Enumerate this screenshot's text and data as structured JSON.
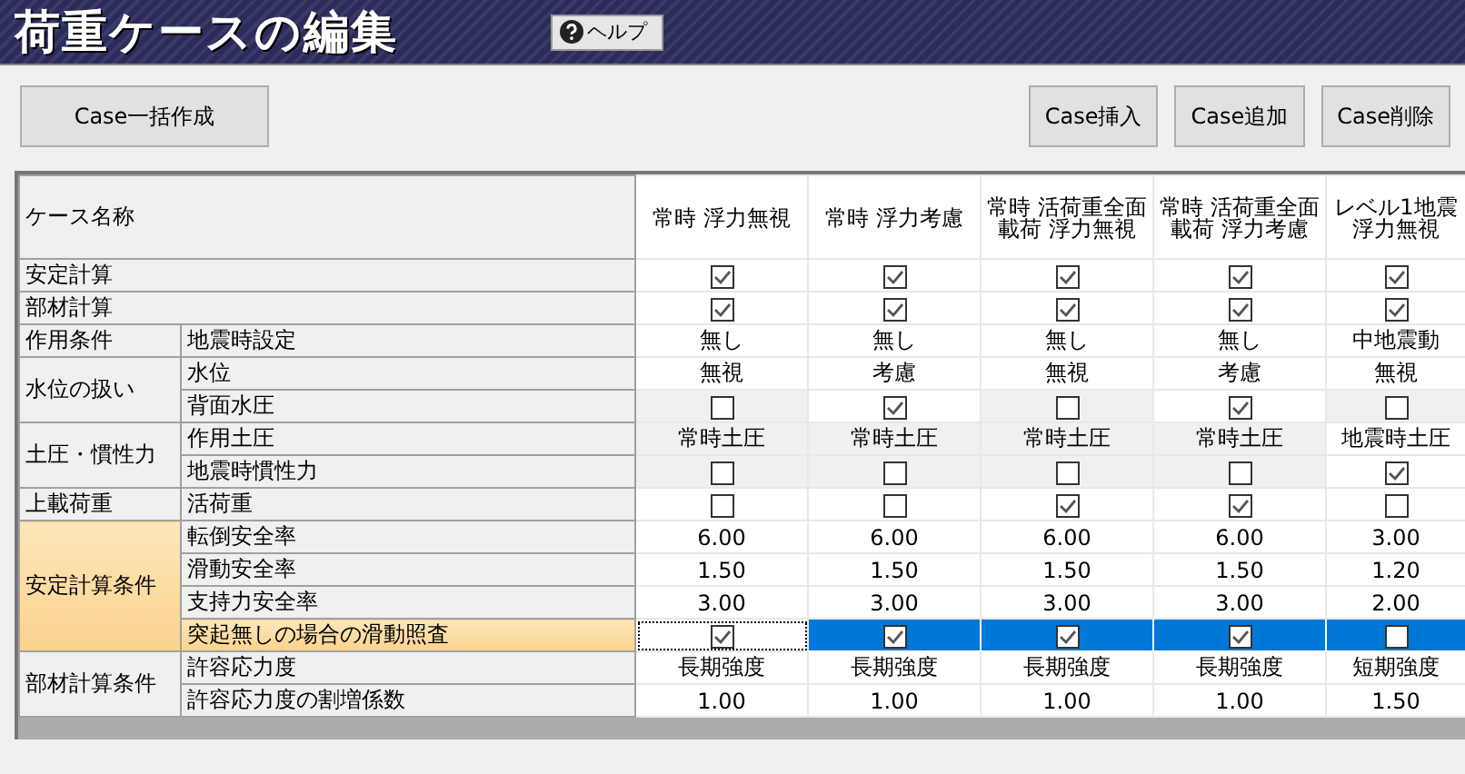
{
  "title": "荷重ケースの編集",
  "help_button": "ヘルプ",
  "toolbar": {
    "left": [
      "Case一括作成"
    ],
    "right": [
      "Case挿入",
      "Case追加",
      "Case削除"
    ]
  },
  "grid": {
    "corner": "ケース名称",
    "cases": [
      "常時 浮力無視",
      "常時 浮力考慮",
      "常時 活荷重全面載荷 浮力無視",
      "常時 活荷重全面載荷 浮力考慮",
      "レベル1地震浮力無視"
    ],
    "groups": [
      {
        "label": "安定計算",
        "rows": [
          {
            "selected": false,
            "cells": [
              {
                "kind": "check",
                "checked": true,
                "disabled": false
              },
              {
                "kind": "check",
                "checked": true,
                "disabled": false
              },
              {
                "kind": "check",
                "checked": true,
                "disabled": false
              },
              {
                "kind": "check",
                "checked": true,
                "disabled": false
              },
              {
                "kind": "check",
                "checked": true,
                "disabled": false
              }
            ]
          }
        ]
      },
      {
        "label": "部材計算",
        "rows": [
          {
            "selected": false,
            "cells": [
              {
                "kind": "check",
                "checked": true,
                "disabled": false
              },
              {
                "kind": "check",
                "checked": true,
                "disabled": false
              },
              {
                "kind": "check",
                "checked": true,
                "disabled": false
              },
              {
                "kind": "check",
                "checked": true,
                "disabled": false
              },
              {
                "kind": "check",
                "checked": true,
                "disabled": false
              }
            ]
          }
        ]
      },
      {
        "label": "作用条件",
        "rows": [
          {
            "label": "地震時設定",
            "selected": false,
            "cells": [
              {
                "kind": "text",
                "text": "無し",
                "disabled": false
              },
              {
                "kind": "text",
                "text": "無し",
                "disabled": false
              },
              {
                "kind": "text",
                "text": "無し",
                "disabled": false
              },
              {
                "kind": "text",
                "text": "無し",
                "disabled": false
              },
              {
                "kind": "text",
                "text": "中地震動",
                "disabled": false
              }
            ]
          }
        ]
      },
      {
        "label": "水位の扱い",
        "rows": [
          {
            "label": "水位",
            "selected": false,
            "cells": [
              {
                "kind": "text",
                "text": "無視",
                "disabled": false
              },
              {
                "kind": "text",
                "text": "考慮",
                "disabled": false
              },
              {
                "kind": "text",
                "text": "無視",
                "disabled": false
              },
              {
                "kind": "text",
                "text": "考慮",
                "disabled": false
              },
              {
                "kind": "text",
                "text": "無視",
                "disabled": false
              }
            ]
          },
          {
            "label": "背面水圧",
            "selected": false,
            "cells": [
              {
                "kind": "check",
                "checked": false,
                "disabled": true
              },
              {
                "kind": "check",
                "checked": true,
                "disabled": false
              },
              {
                "kind": "check",
                "checked": false,
                "disabled": true
              },
              {
                "kind": "check",
                "checked": true,
                "disabled": false
              },
              {
                "kind": "check",
                "checked": false,
                "disabled": true
              }
            ]
          }
        ]
      },
      {
        "label": "土圧・慣性力",
        "rows": [
          {
            "label": "作用土圧",
            "selected": false,
            "cells": [
              {
                "kind": "text",
                "text": "常時土圧",
                "disabled": true
              },
              {
                "kind": "text",
                "text": "常時土圧",
                "disabled": true
              },
              {
                "kind": "text",
                "text": "常時土圧",
                "disabled": true
              },
              {
                "kind": "text",
                "text": "常時土圧",
                "disabled": true
              },
              {
                "kind": "text",
                "text": "地震時土圧",
                "disabled": false
              }
            ]
          },
          {
            "label": "地震時慣性力",
            "selected": false,
            "cells": [
              {
                "kind": "check",
                "checked": false,
                "disabled": true
              },
              {
                "kind": "check",
                "checked": false,
                "disabled": true
              },
              {
                "kind": "check",
                "checked": false,
                "disabled": true
              },
              {
                "kind": "check",
                "checked": false,
                "disabled": true
              },
              {
                "kind": "check",
                "checked": true,
                "disabled": false
              }
            ]
          }
        ]
      },
      {
        "label": "上載荷重",
        "rows": [
          {
            "label": "活荷重",
            "selected": false,
            "cells": [
              {
                "kind": "check",
                "checked": false,
                "disabled": false
              },
              {
                "kind": "check",
                "checked": false,
                "disabled": false
              },
              {
                "kind": "check",
                "checked": true,
                "disabled": false
              },
              {
                "kind": "check",
                "checked": true,
                "disabled": false
              },
              {
                "kind": "check",
                "checked": false,
                "disabled": false
              }
            ]
          }
        ]
      },
      {
        "label": "安定計算条件",
        "rows": [
          {
            "label": "転倒安全率",
            "selected": false,
            "cells": [
              {
                "kind": "text",
                "text": "6.00",
                "disabled": false
              },
              {
                "kind": "text",
                "text": "6.00",
                "disabled": false
              },
              {
                "kind": "text",
                "text": "6.00",
                "disabled": false
              },
              {
                "kind": "text",
                "text": "6.00",
                "disabled": false
              },
              {
                "kind": "text",
                "text": "3.00",
                "disabled": false
              }
            ]
          },
          {
            "label": "滑動安全率",
            "selected": false,
            "cells": [
              {
                "kind": "text",
                "text": "1.50",
                "disabled": false
              },
              {
                "kind": "text",
                "text": "1.50",
                "disabled": false
              },
              {
                "kind": "text",
                "text": "1.50",
                "disabled": false
              },
              {
                "kind": "text",
                "text": "1.50",
                "disabled": false
              },
              {
                "kind": "text",
                "text": "1.20",
                "disabled": false
              }
            ]
          },
          {
            "label": "支持力安全率",
            "selected": false,
            "cells": [
              {
                "kind": "text",
                "text": "3.00",
                "disabled": false
              },
              {
                "kind": "text",
                "text": "3.00",
                "disabled": false
              },
              {
                "kind": "text",
                "text": "3.00",
                "disabled": false
              },
              {
                "kind": "text",
                "text": "3.00",
                "disabled": false
              },
              {
                "kind": "text",
                "text": "2.00",
                "disabled": false
              }
            ]
          },
          {
            "label": "突起無しの場合の滑動照査",
            "selected": true,
            "cells": [
              {
                "kind": "check",
                "checked": true,
                "focused": true
              },
              {
                "kind": "check",
                "checked": true,
                "focused": false
              },
              {
                "kind": "check",
                "checked": true,
                "focused": false
              },
              {
                "kind": "check",
                "checked": true,
                "focused": false
              },
              {
                "kind": "check",
                "checked": false,
                "focused": false
              }
            ]
          }
        ]
      },
      {
        "label": "部材計算条件",
        "rows": [
          {
            "label": "許容応力度",
            "selected": false,
            "cells": [
              {
                "kind": "text",
                "text": "長期強度",
                "disabled": false
              },
              {
                "kind": "text",
                "text": "長期強度",
                "disabled": false
              },
              {
                "kind": "text",
                "text": "長期強度",
                "disabled": false
              },
              {
                "kind": "text",
                "text": "長期強度",
                "disabled": false
              },
              {
                "kind": "text",
                "text": "短期強度",
                "disabled": false
              }
            ]
          },
          {
            "label": "許容応力度の割増係数",
            "selected": false,
            "cells": [
              {
                "kind": "text",
                "text": "1.00",
                "disabled": false
              },
              {
                "kind": "text",
                "text": "1.00",
                "disabled": false
              },
              {
                "kind": "text",
                "text": "1.00",
                "disabled": false
              },
              {
                "kind": "text",
                "text": "1.00",
                "disabled": false
              },
              {
                "kind": "text",
                "text": "1.50",
                "disabled": false
              }
            ]
          }
        ]
      }
    ]
  }
}
